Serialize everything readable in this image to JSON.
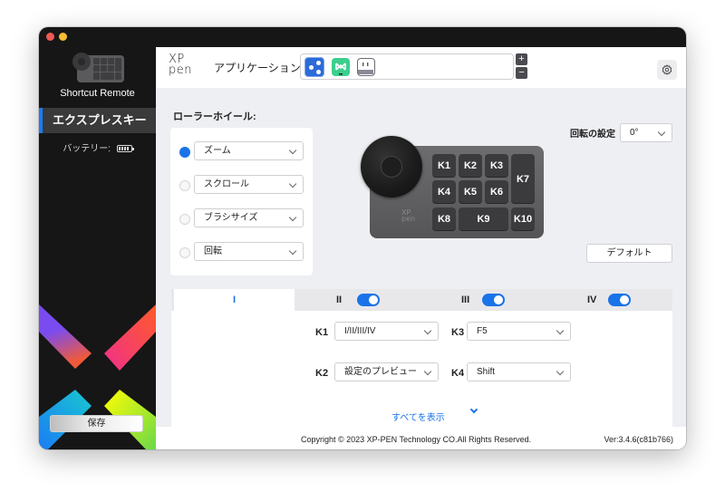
{
  "window": {
    "app_name": "Shortcut Remote"
  },
  "sidebar": {
    "nav_items": [
      {
        "label": "エクスプレスキー",
        "active": true
      }
    ],
    "battery_label": "バッテリー:",
    "save_label": "保存"
  },
  "header": {
    "logo": [
      "XP",
      "pen"
    ],
    "applications_label": "アプリケーション:",
    "applications": [
      {
        "name": "global-settings",
        "selected": true
      },
      {
        "name": "app-2",
        "selected": false
      },
      {
        "name": "app-3",
        "selected": false
      }
    ],
    "add_label": "+",
    "remove_label": "−"
  },
  "roller": {
    "title": "ローラーホイール:",
    "options": [
      {
        "label": "ズーム",
        "selected": true
      },
      {
        "label": "スクロール",
        "selected": false
      },
      {
        "label": "ブラシサイズ",
        "selected": false
      },
      {
        "label": "回転",
        "selected": false
      }
    ]
  },
  "rotation": {
    "label": "回転の設定",
    "value": "0°"
  },
  "device": {
    "keys": [
      "K1",
      "K2",
      "K3",
      "K4",
      "K5",
      "K6",
      "K7",
      "K8",
      "K9",
      "K10"
    ],
    "logo": [
      "XP",
      "pen"
    ]
  },
  "default_label": "デフォルト",
  "groups": {
    "tabs": [
      {
        "label": "I",
        "active": true,
        "enabled": null
      },
      {
        "label": "II",
        "active": false,
        "enabled": true
      },
      {
        "label": "III",
        "active": false,
        "enabled": true
      },
      {
        "label": "IV",
        "active": false,
        "enabled": true
      }
    ],
    "assignments": [
      {
        "key": "K1",
        "value": "I/II/III/IV"
      },
      {
        "key": "K2",
        "value": "設定のプレビュー"
      },
      {
        "key": "K3",
        "value": "F5"
      },
      {
        "key": "K4",
        "value": "Shift"
      }
    ],
    "show_all_label": "すべてを表示"
  },
  "footer": {
    "copyright": "Copyright © 2023  XP-PEN Technology CO.All Rights Reserved.",
    "version": "Ver:3.4.6(c81b766)"
  },
  "colors": {
    "accent": "#1a73e8",
    "sidebar_bg": "#161616",
    "content_bg": "#eeeff2"
  }
}
